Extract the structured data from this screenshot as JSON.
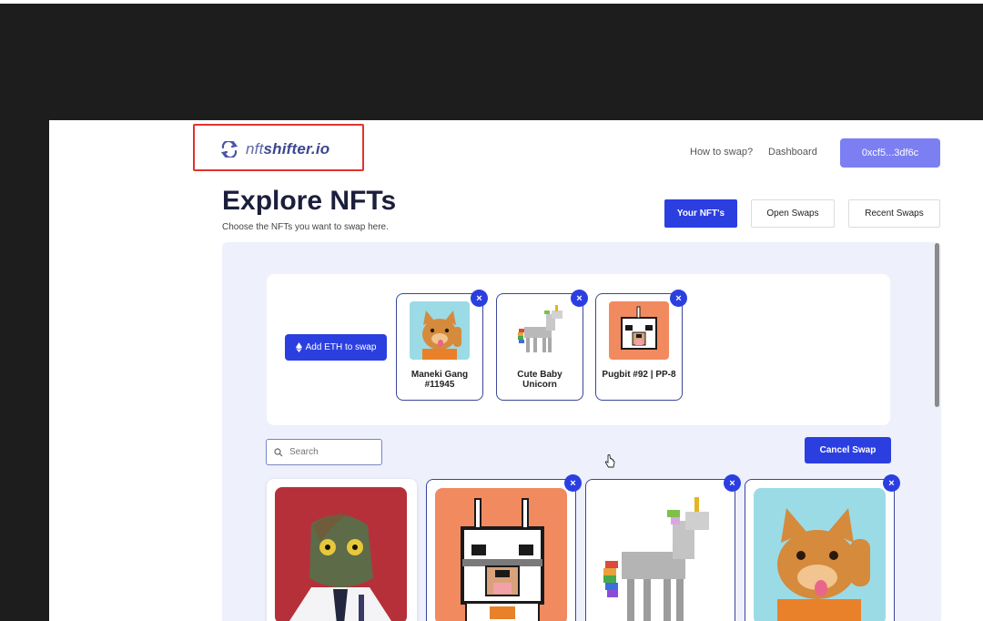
{
  "header": {
    "logo_prefix": "nft",
    "logo_suffix": "shifter.io",
    "nav": [
      "How to swap?",
      "Dashboard"
    ],
    "wallet": "0xcf5...3df6c"
  },
  "page": {
    "title": "Explore NFTs",
    "subtitle": "Choose the NFTs you want to swap here."
  },
  "tabs": [
    {
      "label": "Your NFT's",
      "active": true
    },
    {
      "label": "Open Swaps",
      "active": false
    },
    {
      "label": "Recent Swaps",
      "active": false
    }
  ],
  "swap": {
    "add_eth_label": "Add ETH to swap",
    "selected": [
      {
        "name": "Maneki Gang #11945"
      },
      {
        "name": "Cute Baby Unicorn"
      },
      {
        "name": "Pugbit #92 | PP-8"
      }
    ]
  },
  "search": {
    "placeholder": "Search"
  },
  "cancel_label": "Cancel Swap",
  "remove_symbol": "×",
  "colors": {
    "accent": "#2b3fe0",
    "wallet": "#7b7ff2",
    "panel": "#eef0fb"
  }
}
